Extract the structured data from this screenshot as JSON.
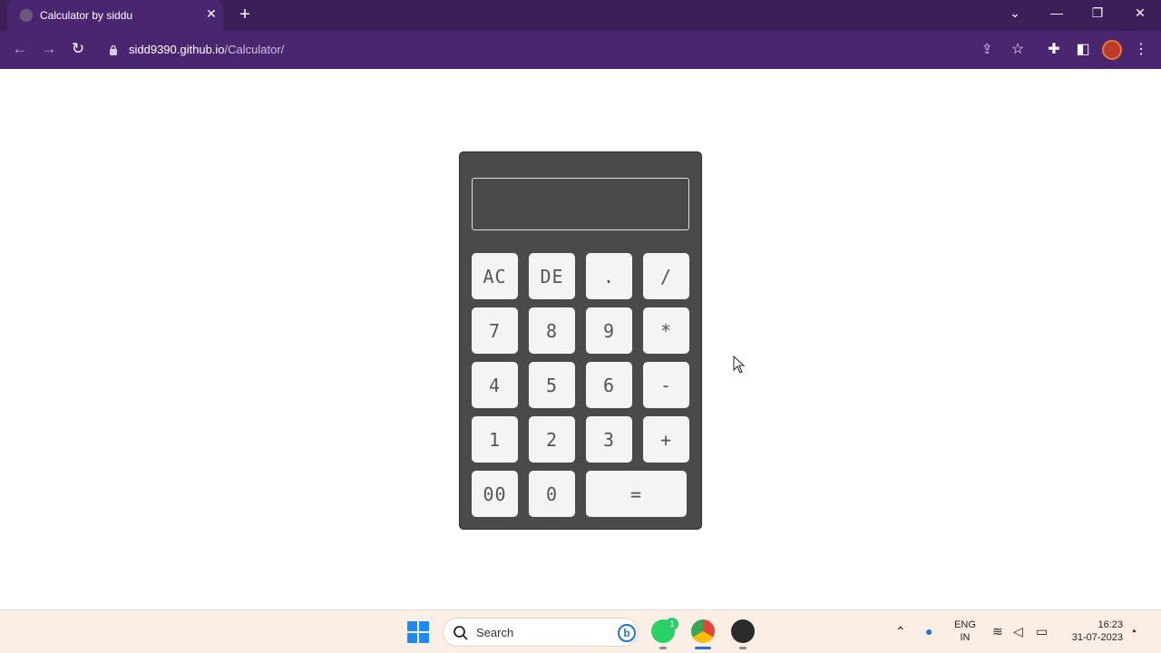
{
  "browser": {
    "tab_title": "Calculator by siddu",
    "tab_close": "✕",
    "new_tab": "+",
    "url_host": "sidd9390.github.io",
    "url_path": "/Calculator/",
    "controls": {
      "dropdown": "⌄",
      "minimize": "—",
      "restore": "❐",
      "close": "✕"
    }
  },
  "calculator": {
    "display_value": "",
    "keys": [
      {
        "id": "ac",
        "label": "AC"
      },
      {
        "id": "de",
        "label": "DE"
      },
      {
        "id": "dot",
        "label": "."
      },
      {
        "id": "divide",
        "label": "/"
      },
      {
        "id": "7",
        "label": "7"
      },
      {
        "id": "8",
        "label": "8"
      },
      {
        "id": "9",
        "label": "9"
      },
      {
        "id": "multiply",
        "label": "*"
      },
      {
        "id": "4",
        "label": "4"
      },
      {
        "id": "5",
        "label": "5"
      },
      {
        "id": "6",
        "label": "6"
      },
      {
        "id": "minus",
        "label": "-"
      },
      {
        "id": "1",
        "label": "1"
      },
      {
        "id": "2",
        "label": "2"
      },
      {
        "id": "3",
        "label": "3"
      },
      {
        "id": "plus",
        "label": "+"
      },
      {
        "id": "00",
        "label": "00"
      },
      {
        "id": "0",
        "label": "0"
      },
      {
        "id": "equals",
        "label": "="
      }
    ]
  },
  "taskbar": {
    "search_label": "Search",
    "bing_label": "b",
    "whatsapp_badge": "1",
    "lang_line1": "ENG",
    "lang_line2": "IN",
    "time": "16:23",
    "date": "31-07-2023"
  },
  "colors": {
    "tabstrip": "#3b1f57",
    "toolbar": "#4a2670",
    "calc_body": "#4a4a4a",
    "key_bg": "#f4f4f4",
    "taskbar": "#fbeee5"
  }
}
